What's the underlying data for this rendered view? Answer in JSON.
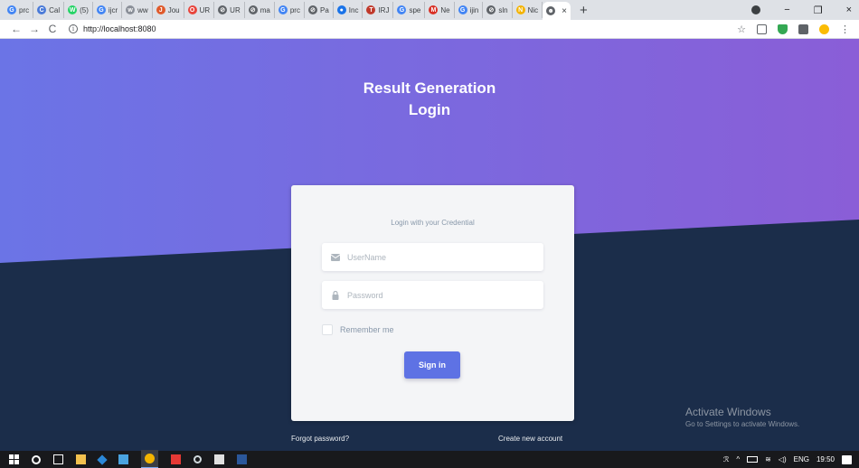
{
  "browser": {
    "tabs": [
      {
        "title": "prc",
        "icon": "google-icon",
        "color": "#4285f4",
        "glyph": "G"
      },
      {
        "title": "Cal",
        "icon": "cal-icon",
        "color": "#4a7ad8",
        "glyph": "C"
      },
      {
        "title": "(5)",
        "icon": "whatsapp-icon",
        "color": "#25d366",
        "glyph": "W"
      },
      {
        "title": "ijcr",
        "icon": "google-icon",
        "color": "#4285f4",
        "glyph": "G"
      },
      {
        "title": "ww",
        "icon": "site-icon",
        "color": "#8a8f98",
        "glyph": "w"
      },
      {
        "title": "Jou",
        "icon": "journal-icon",
        "color": "#e05a2b",
        "glyph": "J"
      },
      {
        "title": "UR",
        "icon": "circle-icon",
        "color": "#e8453c",
        "glyph": "O"
      },
      {
        "title": "UR",
        "icon": "globe-icon",
        "color": "#5f6368",
        "glyph": "⊘"
      },
      {
        "title": "ma",
        "icon": "globe-icon",
        "color": "#5f6368",
        "glyph": "⊘"
      },
      {
        "title": "prc",
        "icon": "google-icon",
        "color": "#4285f4",
        "glyph": "G"
      },
      {
        "title": "Pa",
        "icon": "globe-icon",
        "color": "#5f6368",
        "glyph": "⊘"
      },
      {
        "title": "Inc",
        "icon": "dot-icon",
        "color": "#1a73e8",
        "glyph": "●"
      },
      {
        "title": "IRJ",
        "icon": "flag-icon",
        "color": "#c0392b",
        "glyph": "T"
      },
      {
        "title": "spe",
        "icon": "google-icon",
        "color": "#4285f4",
        "glyph": "G"
      },
      {
        "title": "Ne",
        "icon": "gmail-icon",
        "color": "#d93025",
        "glyph": "M"
      },
      {
        "title": "ijin",
        "icon": "google-icon",
        "color": "#4285f4",
        "glyph": "G"
      },
      {
        "title": "sln",
        "icon": "globe-icon",
        "color": "#5f6368",
        "glyph": "⊘"
      },
      {
        "title": "Nic",
        "icon": "nic-icon",
        "color": "#f4b400",
        "glyph": "N"
      }
    ],
    "active_tab": {
      "icon": "owl-icon",
      "color": "#5f6368"
    },
    "close_glyph": "×",
    "new_tab_glyph": "+",
    "url": "http://localhost:8080",
    "nav": {
      "back": "←",
      "forward": "→",
      "reload": "C"
    },
    "window": {
      "minimize": "−",
      "restore": "❐",
      "close": "×"
    },
    "bookmark_glyph": "☆"
  },
  "page": {
    "title_line1": "Result Generation",
    "title_line2": "Login",
    "colors": {
      "gradient_start": "#6b74e6",
      "gradient_end": "#8a5ed7",
      "dark": "#1b2d4a",
      "accent": "#5e72e4"
    },
    "card": {
      "subtitle": "Login with your Credential",
      "username_placeholder": "UserName",
      "password_placeholder": "Password",
      "remember_label": "Remember me",
      "signin_label": "Sign in"
    },
    "links": {
      "forgot": "Forgot password?",
      "create": "Create new account"
    }
  },
  "watermark": {
    "title": "Activate Windows",
    "subtitle": "Go to Settings to activate Windows."
  },
  "taskbar": {
    "lang": "ENG",
    "time": "19:50"
  }
}
